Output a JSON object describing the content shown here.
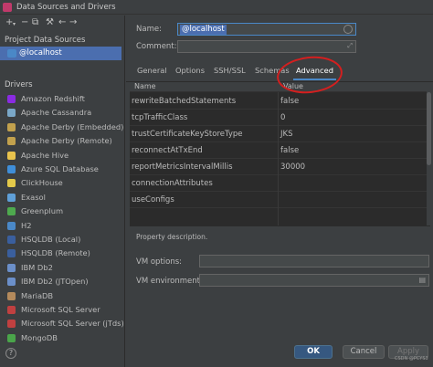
{
  "window": {
    "title": "Data Sources and Drivers"
  },
  "sidebar": {
    "toolbar_icons": [
      "add-icon",
      "remove-icon",
      "copy-icon",
      "wrench-icon",
      "back-icon",
      "forward-icon"
    ],
    "project_section": "Project Data Sources",
    "selected_source": "@localhost",
    "drivers_section": "Drivers",
    "drivers": [
      {
        "label": "Amazon Redshift",
        "color": "#8a2be2"
      },
      {
        "label": "Apache Cassandra",
        "color": "#7aa7c7"
      },
      {
        "label": "Apache Derby (Embedded)",
        "color": "#c2a14d"
      },
      {
        "label": "Apache Derby (Remote)",
        "color": "#c2a14d"
      },
      {
        "label": "Apache Hive",
        "color": "#e8c34d"
      },
      {
        "label": "Azure SQL Database",
        "color": "#3f8ed8"
      },
      {
        "label": "ClickHouse",
        "color": "#e3c94a"
      },
      {
        "label": "Exasol",
        "color": "#5fa0d8"
      },
      {
        "label": "Greenplum",
        "color": "#4ea94e"
      },
      {
        "label": "H2",
        "color": "#4a88c7"
      },
      {
        "label": "HSQLDB (Local)",
        "color": "#3a5f9e"
      },
      {
        "label": "HSQLDB (Remote)",
        "color": "#3a5f9e"
      },
      {
        "label": "IBM Db2",
        "color": "#6b8fc9"
      },
      {
        "label": "IBM Db2 (JTOpen)",
        "color": "#6b8fc9"
      },
      {
        "label": "MariaDB",
        "color": "#b48a5c"
      },
      {
        "label": "Microsoft SQL Server",
        "color": "#c04040"
      },
      {
        "label": "Microsoft SQL Server (jTds)",
        "color": "#c04040"
      },
      {
        "label": "MongoDB",
        "color": "#4aa54a"
      }
    ],
    "help_label": "?"
  },
  "form": {
    "name_label": "Name:",
    "name_value": "@localhost",
    "comment_label": "Comment:",
    "comment_value": ""
  },
  "tabs": [
    {
      "label": "General"
    },
    {
      "label": "Options"
    },
    {
      "label": "SSH/SSL"
    },
    {
      "label": "Schemas"
    },
    {
      "label": "Advanced"
    }
  ],
  "table": {
    "col_name": "Name",
    "col_value": "Value",
    "rows": [
      {
        "name": "rewriteBatchedStatements",
        "value": "false"
      },
      {
        "name": "tcpTrafficClass",
        "value": "0"
      },
      {
        "name": "trustCertificateKeyStoreType",
        "value": "JKS"
      },
      {
        "name": "reconnectAtTxEnd",
        "value": "false"
      },
      {
        "name": "reportMetricsIntervalMillis",
        "value": "30000"
      },
      {
        "name": "connectionAttributes",
        "value": ""
      },
      {
        "name": "useConfigs",
        "value": ""
      }
    ]
  },
  "description": "Property description.",
  "vm": {
    "options_label": "VM options:",
    "environment_label": "VM environment:"
  },
  "buttons": {
    "ok": "OK",
    "cancel": "Cancel",
    "apply": "Apply"
  },
  "watermark": "CSDN @PCYS3",
  "colors": {
    "accent": "#4b6eaf",
    "annotation": "#d41f1f"
  }
}
